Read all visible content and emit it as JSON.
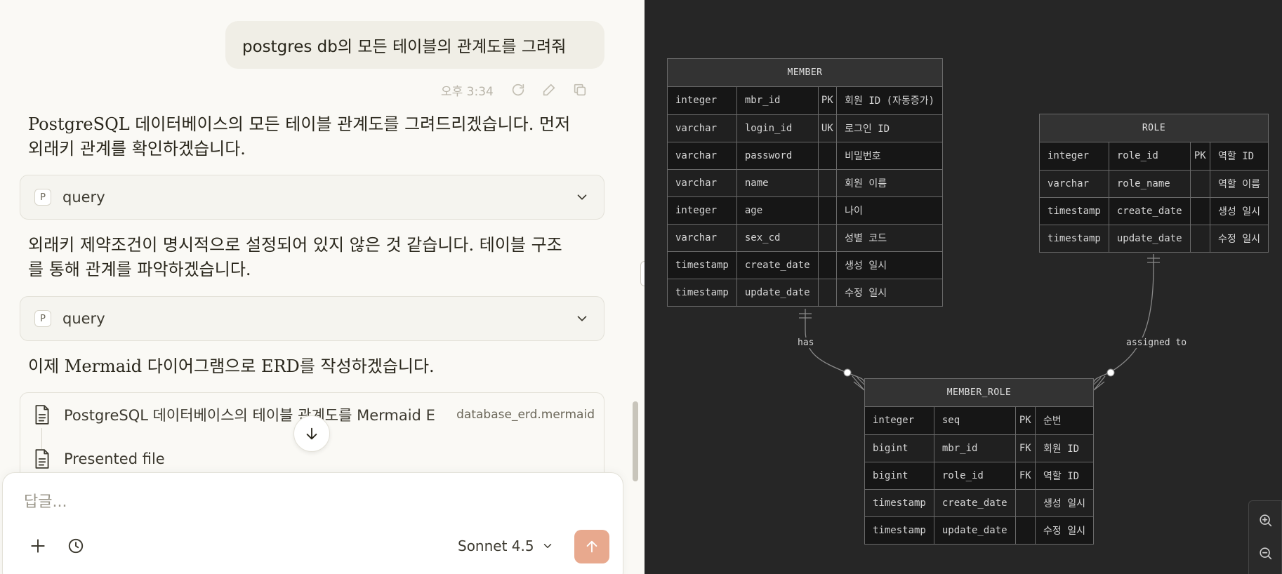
{
  "chat": {
    "user_message": "postgres db의 모든 테이블의 관계도를 그려줘",
    "message_time": "오후 3:34",
    "replies": [
      "PostgreSQL 데이터베이스의 모든 테이블 관계도를 그려드리겠습니다. 먼저 외래키 관계를 확인하겠습니다.",
      "외래키 제약조건이 명시적으로 설정되어 있지 않은 것 같습니다. 테이블 구조를 통해 관계를 파악하겠습니다.",
      "이제 Mermaid 다이어그램으로 ERD를 작성하겠습니다."
    ],
    "tool_calls": [
      {
        "badge": "P",
        "label": "query"
      },
      {
        "badge": "P",
        "label": "query"
      }
    ],
    "artifact": {
      "title": "PostgreSQL 데이터베이스의 테이블 관계도를 Mermaid E",
      "filename": "database_erd.mermaid",
      "presented_label": "Presented file"
    },
    "composer": {
      "placeholder": "답글...",
      "model": "Sonnet 4.5"
    },
    "icons": {
      "retry": "retry-icon",
      "edit": "edit-icon",
      "copy": "copy-icon",
      "chevron": "chevron-down-icon",
      "document": "document-icon",
      "arrow_down": "arrow-down-icon",
      "plus": "plus-icon",
      "history": "history-icon",
      "send": "arrow-up-icon"
    },
    "colors": {
      "background": "#faf9f5",
      "user_bubble": "#f0eee6",
      "send_button": "#e8a98e"
    }
  },
  "diagram": {
    "entities": {
      "member": {
        "name": "MEMBER",
        "rows": [
          [
            "integer",
            "mbr_id",
            "PK",
            "회원 ID (자동증가)"
          ],
          [
            "varchar",
            "login_id",
            "UK",
            "로그인 ID"
          ],
          [
            "varchar",
            "password",
            "",
            "비밀번호"
          ],
          [
            "varchar",
            "name",
            "",
            "회원 이름"
          ],
          [
            "integer",
            "age",
            "",
            "나이"
          ],
          [
            "varchar",
            "sex_cd",
            "",
            "성별 코드"
          ],
          [
            "timestamp",
            "create_date",
            "",
            "생성 일시"
          ],
          [
            "timestamp",
            "update_date",
            "",
            "수정 일시"
          ]
        ]
      },
      "role": {
        "name": "ROLE",
        "rows": [
          [
            "integer",
            "role_id",
            "PK",
            "역할 ID"
          ],
          [
            "varchar",
            "role_name",
            "",
            "역할 이름"
          ],
          [
            "timestamp",
            "create_date",
            "",
            "생성 일시"
          ],
          [
            "timestamp",
            "update_date",
            "",
            "수정 일시"
          ]
        ]
      },
      "member_role": {
        "name": "MEMBER_ROLE",
        "rows": [
          [
            "integer",
            "seq",
            "PK",
            "순번"
          ],
          [
            "bigint",
            "mbr_id",
            "FK",
            "회원 ID"
          ],
          [
            "bigint",
            "role_id",
            "FK",
            "역할 ID"
          ],
          [
            "timestamp",
            "create_date",
            "",
            "생성 일시"
          ],
          [
            "timestamp",
            "update_date",
            "",
            "수정 일시"
          ]
        ]
      }
    },
    "relationships": [
      {
        "label": "has"
      },
      {
        "label": "assigned to"
      }
    ],
    "colors": {
      "background": "#262626",
      "header": "#333333",
      "border": "#6a6a6a"
    }
  }
}
